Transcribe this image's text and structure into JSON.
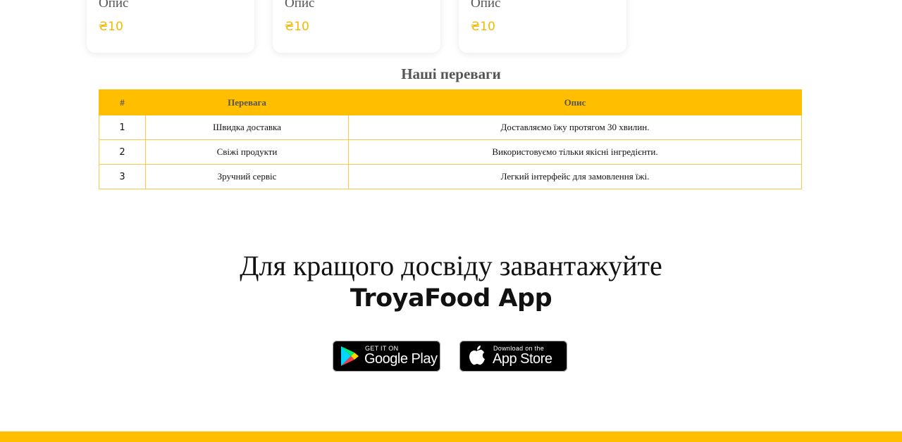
{
  "products": [
    {
      "description": "Опис",
      "price": "₴10"
    },
    {
      "description": "Опис",
      "price": "₴10"
    },
    {
      "description": "Опис",
      "price": "₴10"
    }
  ],
  "advantages": {
    "title": "Наші переваги",
    "headers": [
      "#",
      "Перевага",
      "Опис"
    ],
    "rows": [
      {
        "num": "1",
        "name": "Швидка доставка",
        "desc": "Доставляємо їжу протягом 30 хвилин."
      },
      {
        "num": "2",
        "name": "Свіжі продукти",
        "desc": "Використовуємо тільки якісні інгредієнти."
      },
      {
        "num": "3",
        "name": "Зручний сервіс",
        "desc": "Легкий інтерфейс для замовлення їжі."
      }
    ]
  },
  "app_promo": {
    "line1": "Для кращого досвіду завантажуйте",
    "line2": "TroyaFood App",
    "google_play": {
      "small": "GET IT ON",
      "big": "Google Play"
    },
    "app_store": {
      "small": "Download on the",
      "big": "App Store"
    }
  },
  "colors": {
    "accent": "#ffbe00",
    "price": "#f5b800"
  }
}
